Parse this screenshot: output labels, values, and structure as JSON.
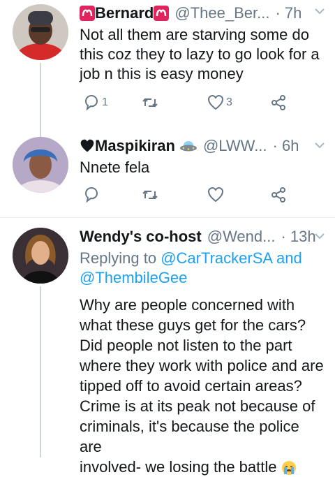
{
  "tweets": [
    {
      "name": "Bernard",
      "handle": "@Thee_Ber...",
      "time": "· 7h",
      "lines": [
        "Not all them are starving some do",
        "this  coz they to lazy to go look for a",
        "job  n this is easy money"
      ],
      "reply_count": "1",
      "like_count": "3"
    },
    {
      "name": "Maspikiran",
      "handle": "@LWW...",
      "time": "· 6h",
      "lines": [
        "Nnete fela"
      ]
    },
    {
      "name": "Wendy's co-host",
      "handle": "@Wend...",
      "time": "· 13h",
      "reply_prefix": "Replying to ",
      "reply_mention_1": "@CarTrackerSA",
      "reply_and": " and",
      "reply_mention_2": "@ThembileGee",
      "lines": [
        "Why are people concerned with",
        "what these guys get for the cars?",
        "Did people not listen to the part",
        "where they work with police and are",
        "tipped off to avoid certain areas?",
        "Crime is at its peak not because of",
        "criminals, it's because the police are",
        "involved- we losing the battle"
      ]
    }
  ],
  "colors": {
    "accent": "#1da1f2",
    "muted": "#657786",
    "text": "#14171a",
    "aries": "#e0245e"
  },
  "icons": [
    "aries-icon",
    "black-heart-icon",
    "flying-saucer-icon",
    "crying-face-icon",
    "reply-icon",
    "retweet-icon",
    "like-icon",
    "share-icon",
    "chevron-down-icon"
  ]
}
